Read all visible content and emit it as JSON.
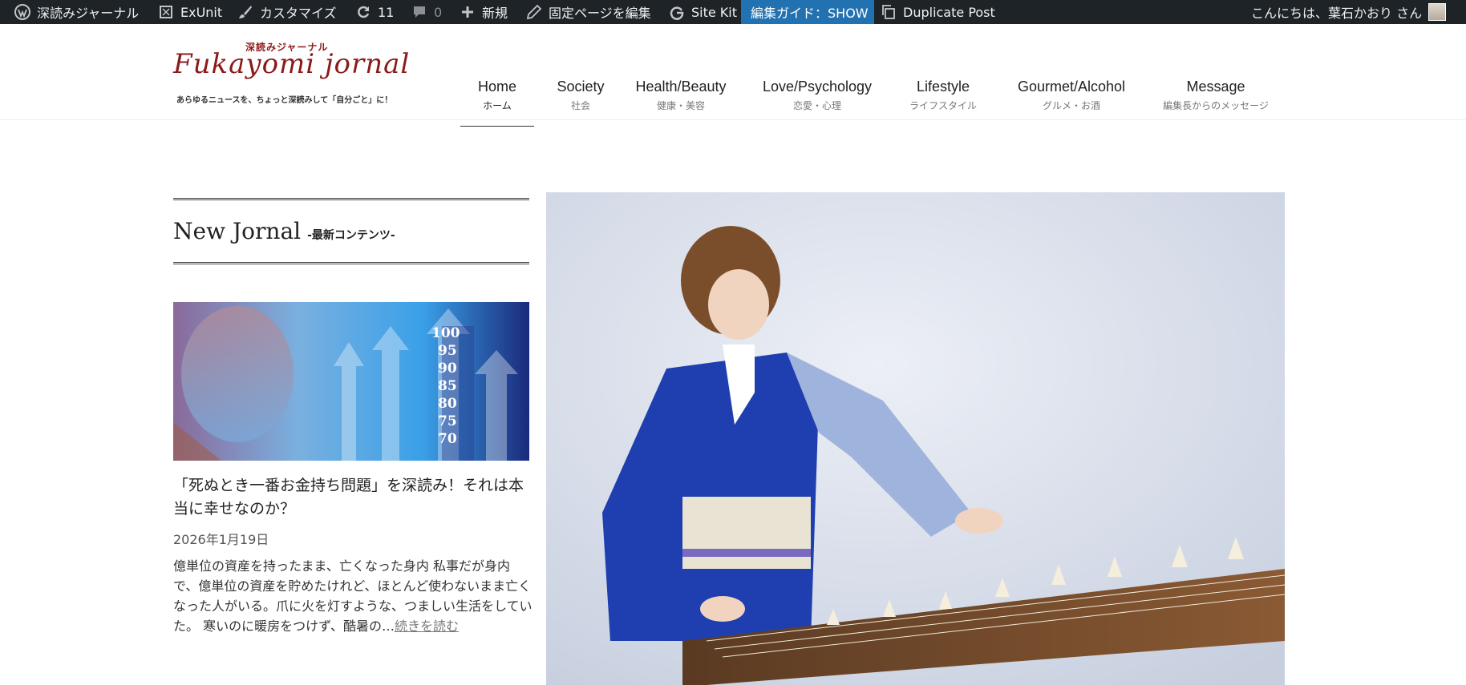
{
  "adminbar": {
    "site_name": "深読みジャーナル",
    "exunit": "ExUnit",
    "customize": "カスタマイズ",
    "updates_count": "11",
    "comments_count": "0",
    "new": "新規",
    "edit_page": "固定ページを編集",
    "site_kit": "Site Kit",
    "guide": "編集ガイド：SHOW",
    "duplicate": "Duplicate Post",
    "greeting": "こんにちは、葉石かおり さん",
    "icons": [
      "wordpress-icon",
      "exunit-icon",
      "brush-icon",
      "refresh-icon",
      "comment-icon",
      "plus-icon",
      "pencil-icon",
      "google-icon",
      "duplicate-icon"
    ],
    "colors": {
      "bg": "#1d2327",
      "highlight": "#2271b1"
    }
  },
  "logo": {
    "jp": "深読みジャーナル",
    "en": "Fukayomi jornal",
    "tagline": "あらゆるニュースを、ちょっと深読みして「自分ごと」に！",
    "color": "#8b1a1a"
  },
  "nav": [
    {
      "en": "Home",
      "ja": "ホーム",
      "active": true
    },
    {
      "en": "Society",
      "ja": "社会"
    },
    {
      "en": "Health/Beauty",
      "ja": "健康・美容"
    },
    {
      "en": "Love/Psychology",
      "ja": "恋愛・心理"
    },
    {
      "en": "Lifestyle",
      "ja": "ライフスタイル"
    },
    {
      "en": "Gourmet/Alcohol",
      "ja": "グルメ・お酒"
    },
    {
      "en": "Message",
      "ja": "編集長からのメッセージ"
    }
  ],
  "section": {
    "title": "New Jornal",
    "subtitle": "-最新コンテンツ-"
  },
  "post": {
    "title": "「死ぬとき一番お金持ち問題」を深読み！それは本当に幸せなのか？",
    "date": "2026年1月19日",
    "excerpt": "億単位の資産を持ったまま、亡くなった身内 私事だが身内で、億単位の資産を貯めたけれど、ほとんど使わないまま亡くなった人がいる。爪に火を灯すような、つましい生活をしていた。 寒いのに暖房をつけず、酷暑の…",
    "more": "続きを読む",
    "thumb_numbers": [
      "100",
      "95",
      "90",
      "85",
      "80",
      "75",
      "70"
    ]
  }
}
